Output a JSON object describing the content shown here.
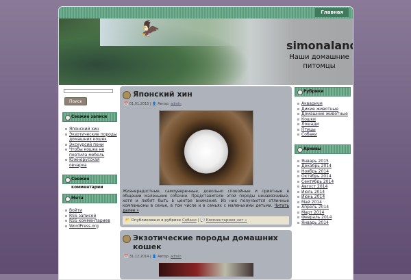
{
  "nav": {
    "home": "Главная"
  },
  "header": {
    "title": "simonaland",
    "subtitle": "Наши домашние питомцы"
  },
  "search": {
    "button": "Поиск",
    "value": ""
  },
  "left": {
    "recent_title": "Свежие записи",
    "recent": [
      "Японский хин",
      "Экзотические породы домашних кошек",
      "Экскурсий пони",
      "Чтобы кошка не портила мебель",
      "Южнорусская овчарка"
    ],
    "comments_title": "Свежие комментарии",
    "meta_title": "Мета",
    "meta": [
      "Войти",
      "RSS записей",
      "RSS комментариев",
      "WordPress.org"
    ]
  },
  "right": {
    "cats_title": "Рубрики",
    "cats": [
      "Аквариум",
      "Дикие животные",
      "Домашние животные",
      "Кошки",
      "Лошади",
      "Птицы",
      "Собаки"
    ],
    "arch_title": "Архивы",
    "arch": [
      "Январь 2015",
      "Декабрь 2014",
      "Ноябрь 2014",
      "Октябрь 2014",
      "Сентябрь 2014",
      "Август 2014",
      "Июль 2014",
      "Июнь 2014",
      "Май 2014",
      "Апрель 2014",
      "Март 2014",
      "Февраль 2014",
      "Январь 2014"
    ]
  },
  "posts": [
    {
      "title": "Японский хин",
      "date": "01.01.2015",
      "author_label": "Автор:",
      "author": "admin",
      "text": "Жизнерадостные, самоуверенные, довольно спокойные и приятные в общении маленькие собачки. Представители этой породы ненавязчивые, хотя и любят быть в центре внимания. Из них получаются отличные компаньоны в семье, в том числе и в семьях с маленькими детьми. ",
      "more": "Читать далее »",
      "posted_in": "Опубликовано в рубрике",
      "category": "Собаки",
      "comments": "Комментариев нет »"
    },
    {
      "title": "Экзотические породы домашних кошек",
      "date": "31.12.2014",
      "author_label": "Автор:",
      "author": "admin"
    }
  ]
}
